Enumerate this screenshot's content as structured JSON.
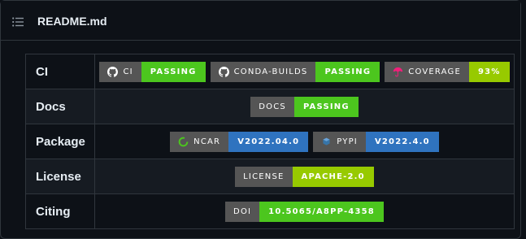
{
  "header": {
    "title": "README.md",
    "toc_icon": "list-icon"
  },
  "rows": [
    {
      "label": "CI",
      "badges": [
        {
          "icon": "github-icon",
          "left": "CI",
          "right": "PASSING",
          "color": "#4cc61e"
        },
        {
          "icon": "github-icon",
          "left": "CONDA-BUILDS",
          "right": "PASSING",
          "color": "#4cc61e"
        },
        {
          "icon": "codecov-umbrella-icon",
          "left": "COVERAGE",
          "right": "93%",
          "color": "#97ca00"
        }
      ]
    },
    {
      "label": "Docs",
      "badges": [
        {
          "left": "DOCS",
          "right": "PASSING",
          "color": "#4cc61e"
        }
      ]
    },
    {
      "label": "Package",
      "badges": [
        {
          "icon": "ncar-ring-icon",
          "left": "NCAR",
          "right": "V2022.04.0",
          "color": "#2f73bf"
        },
        {
          "icon": "pypi-cube-icon",
          "left": "PYPI",
          "right": "V2022.4.0",
          "color": "#2f73bf"
        }
      ]
    },
    {
      "label": "License",
      "badges": [
        {
          "left": "LICENSE",
          "right": "APACHE-2.0",
          "color": "#97ca00"
        }
      ]
    },
    {
      "label": "Citing",
      "badges": [
        {
          "left": "DOI",
          "right": "10.5065/A8PP-4358",
          "color": "#4cc61e"
        }
      ]
    }
  ]
}
